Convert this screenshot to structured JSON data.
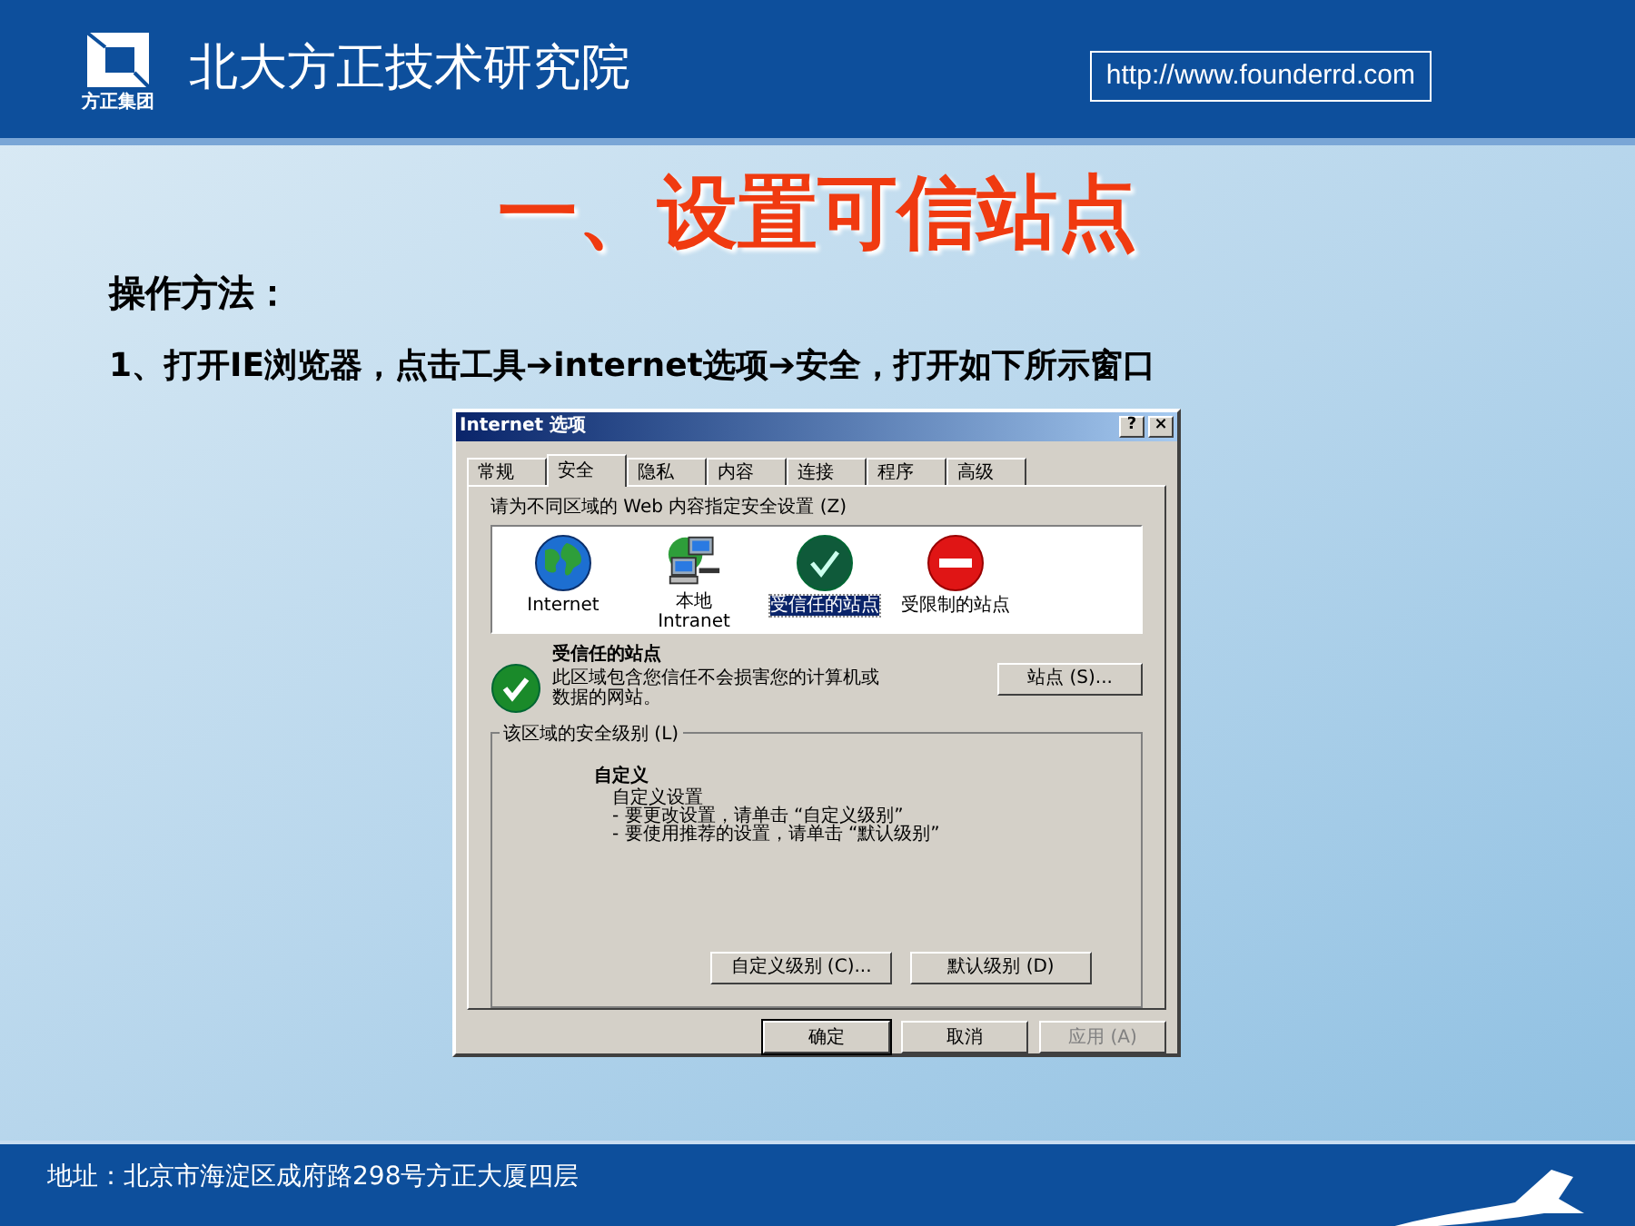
{
  "header": {
    "logo_caption": "方正集团",
    "org_name": "北大方正技术研究院",
    "url": "http://www.founderrd.com"
  },
  "slide": {
    "title": "一、设置可信站点",
    "subtitle": "操作方法：",
    "step": "1、打开IE浏览器，点击工具➔internet选项➔安全，打开如下所示窗口"
  },
  "dialog": {
    "title": "Internet 选项",
    "title_buttons": [
      "?",
      "×"
    ],
    "tabs": [
      {
        "label": "常规",
        "selected": false
      },
      {
        "label": "安全",
        "selected": true
      },
      {
        "label": "隐私",
        "selected": false
      },
      {
        "label": "内容",
        "selected": false
      },
      {
        "label": "连接",
        "selected": false
      },
      {
        "label": "程序",
        "selected": false
      },
      {
        "label": "高级",
        "selected": false
      }
    ],
    "zones_label": "请为不同区域的 Web 内容指定安全设置 (Z)",
    "zones": [
      {
        "kind": "internet",
        "label": "Internet",
        "selected": false
      },
      {
        "kind": "intranet",
        "label": "本地\nIntranet",
        "selected": false
      },
      {
        "kind": "trusted",
        "label": "受信任的站点",
        "selected": true
      },
      {
        "kind": "restricted",
        "label": "受限制的站点",
        "selected": false
      }
    ],
    "zone_title": "受信任的站点",
    "zone_description": "此区域包含您信任不会损害您的计算机或数据的网站。",
    "sites_button": "站点 (S)...",
    "level_group": "该区域的安全级别 (L)",
    "level_name": "自定义",
    "level_lines": [
      "自定义设置",
      "- 要更改设置，请单击 “自定义级别”",
      "- 要使用推荐的设置，请单击 “默认级别”"
    ],
    "level_buttons": [
      "自定义级别 (C)...",
      "默认级别 (D)"
    ],
    "buttons": [
      {
        "label": "确定",
        "disabled": false
      },
      {
        "label": "取消",
        "disabled": false
      },
      {
        "label": "应用 (A)",
        "disabled": true
      }
    ]
  },
  "footer": {
    "address": "地址：北京市海淀区成府路298号方正大厦四层"
  }
}
